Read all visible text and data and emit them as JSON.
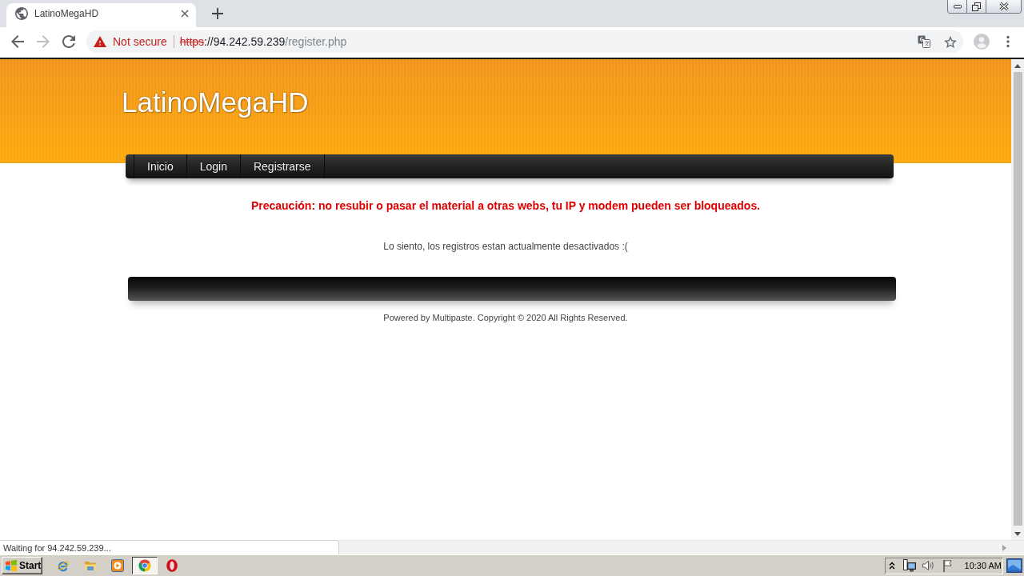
{
  "browser": {
    "tabs": [
      {
        "title": "LatinoMegaHD",
        "selected": true
      }
    ],
    "toolbar_buttons": [
      {
        "kind": "back",
        "disabled": false
      },
      {
        "kind": "forward",
        "disabled": true
      },
      {
        "kind": "reload",
        "disabled": false
      }
    ],
    "address_bar": {
      "secure": false,
      "security_label": "Not secure",
      "scheme": "https",
      "host": "://94.242.59.239",
      "path": "/register.php"
    }
  },
  "page": {
    "site_title": "LatinoMegaHD",
    "nav": [
      {
        "label": "Inicio"
      },
      {
        "label": "Login"
      },
      {
        "label": "Registrarse"
      }
    ],
    "warning": "Precaución: no resubir o pasar el material a otras webs, tu IP y modem pueden ser bloqueados.",
    "message": "Lo siento, los registros estan actualmente desactivados :(",
    "footer": "Powered by Multipaste. Copyright © 2020 All Rights Reserved."
  },
  "status_bar": {
    "text": "Waiting for 94.242.59.239..."
  },
  "taskbar": {
    "start_label": "Start",
    "apps": [
      {
        "kind": "ie",
        "selected": false
      },
      {
        "kind": "explorer",
        "selected": false
      },
      {
        "kind": "media",
        "selected": false
      },
      {
        "kind": "chrome",
        "selected": true
      },
      {
        "kind": "opera",
        "selected": false
      }
    ],
    "clock": "10:30 AM"
  }
}
